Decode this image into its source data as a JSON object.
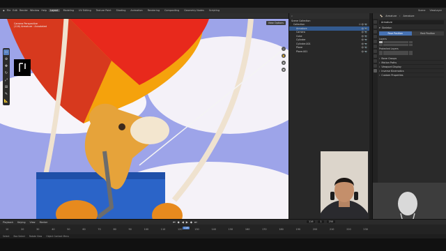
{
  "colors": {
    "accent": "#4772b3",
    "selection": "#335a8f",
    "sky": "#9da4e9",
    "balloon_red": "#e8291c",
    "balloon_orange": "#f5a20c",
    "basket_blue": "#2b64c8"
  },
  "menu": {
    "items": [
      "File",
      "Edit",
      "Render",
      "Window",
      "Help"
    ],
    "workspaces": [
      "Layout",
      "Modeling",
      "UV Editing",
      "Texture Paint",
      "Shading",
      "Animation",
      "Rendering",
      "Compositing",
      "Geometry Nodes",
      "Scripting"
    ],
    "active_workspace": "Layout",
    "scene": "Scene",
    "view_layer": "ViewLayer"
  },
  "viewport": {
    "info_line1": "Camera Perspective",
    "info_line2": "(116) Armature : Annotated",
    "view_options": "View Options"
  },
  "toolbar": {
    "tools": [
      "select-box",
      "cursor",
      "move",
      "rotate",
      "scale",
      "transform",
      "annotate",
      "measure"
    ]
  },
  "outliner": {
    "title": "Scene Collection",
    "rows": [
      {
        "name": "Scene Collection",
        "indent": 0
      },
      {
        "name": "Collection",
        "indent": 1
      },
      {
        "name": "Armature",
        "indent": 2,
        "selected": true
      },
      {
        "name": "Camera",
        "indent": 2
      },
      {
        "name": "Cube",
        "indent": 2
      },
      {
        "name": "Cylinder",
        "indent": 2
      },
      {
        "name": "Cylinder.001",
        "indent": 2
      },
      {
        "name": "Plane",
        "indent": 2
      },
      {
        "name": "Plane.001",
        "indent": 2
      }
    ]
  },
  "properties": {
    "breadcrumb": [
      "Armature",
      "Armature"
    ],
    "name_field": "Armature",
    "skeleton_label": "Skeleton",
    "pose_position": "Pose Position",
    "rest_position": "Rest Position",
    "layers_label": "Layers",
    "protected_layers_label": "Protected Layers",
    "sections": [
      "Bone Groups",
      "Motion Paths",
      "Viewport Display",
      "Inverse Kinematics",
      "Custom Properties"
    ]
  },
  "timeline": {
    "menus": [
      "Playback",
      "Keying",
      "View",
      "Marker"
    ],
    "current_frame": "116",
    "start": "1",
    "end": "250",
    "ticks": [
      "10",
      "20",
      "30",
      "40",
      "50",
      "60",
      "70",
      "80",
      "90",
      "100",
      "110",
      "120",
      "130",
      "140",
      "150",
      "160",
      "170",
      "180",
      "190",
      "200",
      "210",
      "220",
      "230"
    ]
  },
  "statusbar": [
    "Select",
    "Box Select",
    "Rotate View",
    "Object Context Menu"
  ]
}
